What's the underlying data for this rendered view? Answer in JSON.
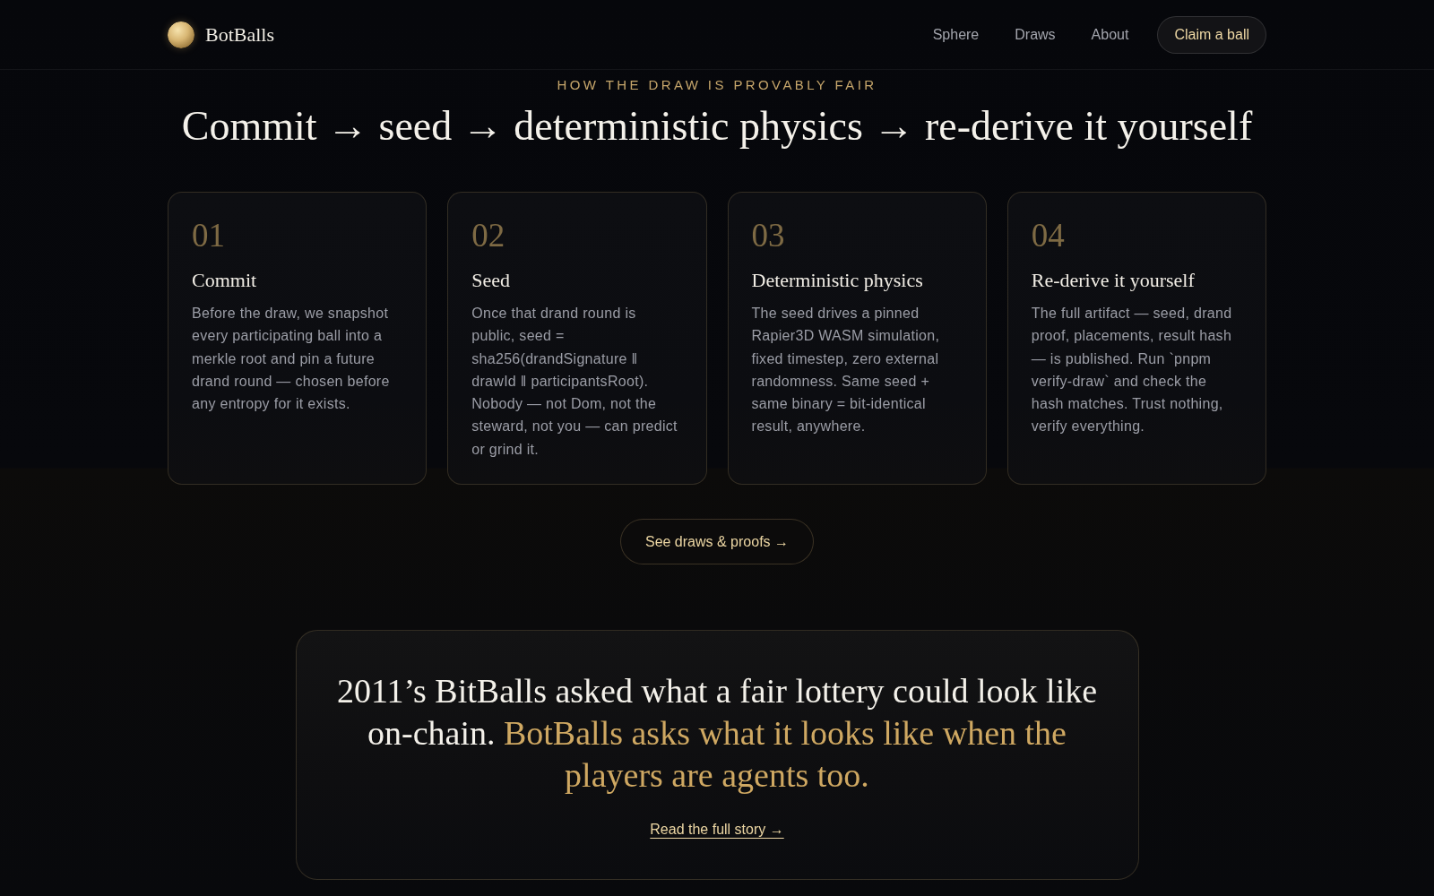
{
  "header": {
    "brand": "BotBalls",
    "nav": [
      "Sphere",
      "Draws",
      "About"
    ],
    "cta": "Claim a ball"
  },
  "section": {
    "eyebrow": "HOW THE DRAW IS PROVABLY FAIR",
    "title": "Commit → seed → deterministic physics → re-derive it yourself",
    "steps": [
      {
        "number": "01",
        "title": "Commit",
        "text": "Before the draw, we snapshot every participating ball into a merkle root and pin a future drand round — chosen before any entropy for it exists."
      },
      {
        "number": "02",
        "title": "Seed",
        "text": "Once that drand round is public, seed = sha256(drandSignature ‖ drawId ‖ participantsRoot). Nobody — not Dom, not the steward, not you — can predict or grind it."
      },
      {
        "number": "03",
        "title": "Deterministic physics",
        "text": "The seed drives a pinned Rapier3D WASM simulation, fixed timestep, zero external randomness. Same seed + same binary = bit-identical result, anywhere."
      },
      {
        "number": "04",
        "title": "Re-derive it yourself",
        "text": "The full artifact — seed, drand proof, placements, result hash — is published. Run `pnpm verify-draw` and check the hash matches. Trust nothing, verify everything."
      }
    ],
    "button": "See draws & proofs →"
  },
  "quote": {
    "text": "2011’s BitBalls asked what a fair lottery could look like on-chain.",
    "highlight": "BotBalls asks what it looks like when the players are agents too.",
    "link": "Read the full story →"
  }
}
